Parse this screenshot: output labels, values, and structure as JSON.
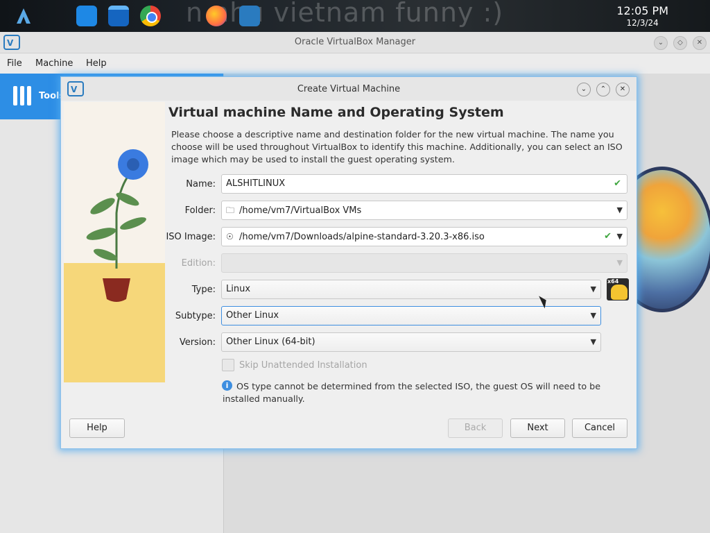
{
  "taskbar": {
    "background_text": "n nhu vietnam funny :)",
    "clock_time": "12:05 PM",
    "clock_date": "12/3/24"
  },
  "main_window": {
    "title": "Oracle VirtualBox Manager",
    "menu": [
      "File",
      "Machine",
      "Help"
    ],
    "tools_label": "Tools"
  },
  "dialog": {
    "title": "Create Virtual Machine",
    "heading": "Virtual machine Name and Operating System",
    "description": "Please choose a descriptive name and destination folder for the new virtual machine. The name you choose will be used throughout VirtualBox to identify this machine. Additionally, you can select an ISO image which may be used to install the guest operating system.",
    "fields": {
      "name": {
        "label": "Name:",
        "value": "ALSHITLINUX"
      },
      "folder": {
        "label": "Folder:",
        "value": "/home/vm7/VirtualBox VMs"
      },
      "iso": {
        "label": "ISO Image:",
        "value": "/home/vm7/Downloads/alpine-standard-3.20.3-x86.iso"
      },
      "edition": {
        "label": "Edition:",
        "value": ""
      },
      "type": {
        "label": "Type:",
        "value": "Linux"
      },
      "subtype": {
        "label": "Subtype:",
        "value": "Other Linux"
      },
      "version": {
        "label": "Version:",
        "value": "Other Linux (64-bit)"
      }
    },
    "skip_unattended_label": "Skip Unattended Installation",
    "info_text": "OS type cannot be determined from the selected ISO, the guest OS will need to be installed manually.",
    "os_badge": "x64",
    "buttons": {
      "help": "Help",
      "back": "Back",
      "next": "Next",
      "cancel": "Cancel"
    }
  },
  "colors": {
    "accent": "#2d8ee5",
    "check": "#3fa63f"
  }
}
